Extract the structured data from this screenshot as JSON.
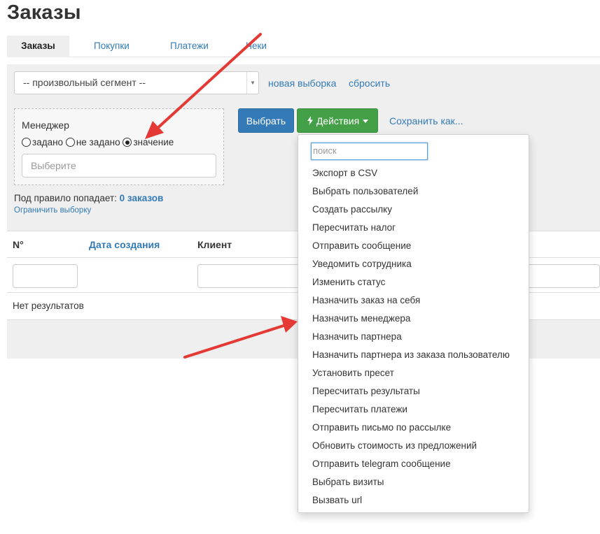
{
  "page": {
    "title": "Заказы"
  },
  "tabs": [
    {
      "label": "Заказы",
      "active": true
    },
    {
      "label": "Покупки",
      "active": false
    },
    {
      "label": "Платежи",
      "active": false
    },
    {
      "label": "Чеки",
      "active": false
    }
  ],
  "filter": {
    "segment_value": "-- произвольный сегмент --",
    "new_selection": "новая выборка",
    "reset": "сбросить",
    "manager_label": "Менеджер",
    "radio_options": [
      "задано",
      "не задано",
      "значение"
    ],
    "radio_selected": "значение",
    "manager_placeholder": "Выберите",
    "select_button": "Выбрать",
    "actions_button": "Действия",
    "save_as": "Сохранить как...",
    "rule_prefix": "Под правило попадает:",
    "rule_count": "0 заказов",
    "limit_link": "Ограничить выборку"
  },
  "table": {
    "columns": [
      "N°",
      "Дата создания",
      "Клиент"
    ],
    "empty_text": "Нет результатов"
  },
  "dropdown": {
    "search_placeholder": "поиск",
    "items": [
      "Экспорт в CSV",
      "Выбрать пользователей",
      "Создать рассылку",
      "Пересчитать налог",
      "Отправить сообщение",
      "Уведомить сотрудника",
      "Изменить статус",
      "Назначить заказ на себя",
      "Назначить менеджера",
      "Назначить партнера",
      "Назначить партнера из заказа пользователю",
      "Установить пресет",
      "Пересчитать результаты",
      "Пересчитать платежи",
      "Отправить письмо по рассылке",
      "Обновить стоимость из предложений",
      "Отправить telegram сообщение",
      "Выбрать визиты",
      "Вызвать url"
    ]
  },
  "colors": {
    "link": "#337ab7",
    "primary_button": "#337ab7",
    "actions_button": "#43a047",
    "annotation_arrow": "#e53935"
  },
  "icons": {
    "actions": "lightning-icon",
    "caret": "caret-down-icon"
  }
}
